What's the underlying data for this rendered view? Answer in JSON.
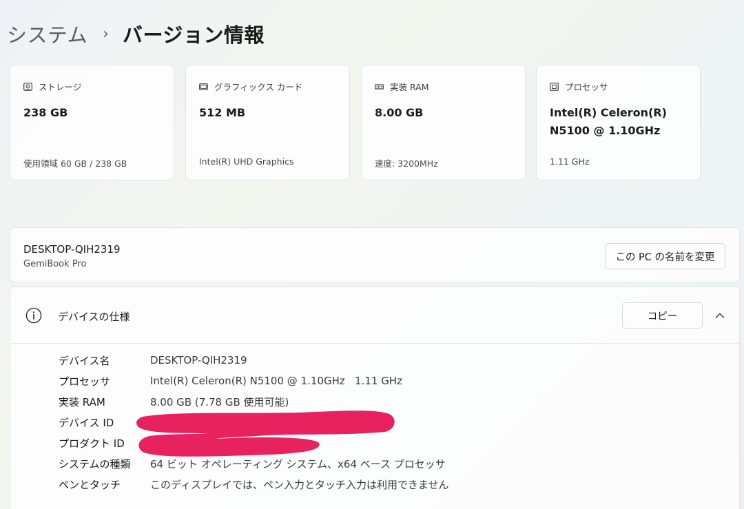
{
  "breadcrumb": {
    "parent": "システム",
    "separator": "›",
    "current": "バージョン情報"
  },
  "cards": [
    {
      "icon": "storage-icon",
      "label": "ストレージ",
      "value": "238 GB",
      "sub": "使用領域 60 GB / 238 GB"
    },
    {
      "icon": "graphics-card-icon",
      "label": "グラフィックス カード",
      "value": "512 MB",
      "sub": "Intel(R) UHD Graphics"
    },
    {
      "icon": "ram-icon",
      "label": "実装 RAM",
      "value": "8.00 GB",
      "sub": "速度: 3200MHz"
    },
    {
      "icon": "processor-icon",
      "label": "プロセッサ",
      "value_line1": "Intel(R) Celeron(R)",
      "value_line2": "N5100 @ 1.10GHz",
      "sub": "1.11 GHz"
    }
  ],
  "device": {
    "name": "DESKTOP-QIH2319",
    "model": "GemiBook Pro",
    "rename_label": "この PC の名前を変更"
  },
  "specs": {
    "title": "デバイスの仕様",
    "copy_label": "コピー",
    "rows": [
      {
        "key": "デバイス名",
        "value": "DESKTOP-QIH2319"
      },
      {
        "key": "プロセッサ",
        "value": "Intel(R) Celeron(R) N5100 @ 1.10GHz   1.11 GHz"
      },
      {
        "key": "実装 RAM",
        "value": "8.00 GB (7.78 GB 使用可能)"
      },
      {
        "key": "デバイス ID",
        "value": ""
      },
      {
        "key": "プロダクト ID",
        "value": ""
      },
      {
        "key": "システムの種類",
        "value": "64 ビット オペレーティング システム、x64 ベース プロセッサ"
      },
      {
        "key": "ペンとタッチ",
        "value": "このディスプレイでは、ペン入力とタッチ入力は利用できません"
      }
    ]
  },
  "colors": {
    "redaction": "#e8215f",
    "card_bg": "#fdfdfd",
    "border": "#e1e3e6"
  },
  "icons": {
    "info": "info-icon",
    "collapse": "chevron-up-icon"
  }
}
